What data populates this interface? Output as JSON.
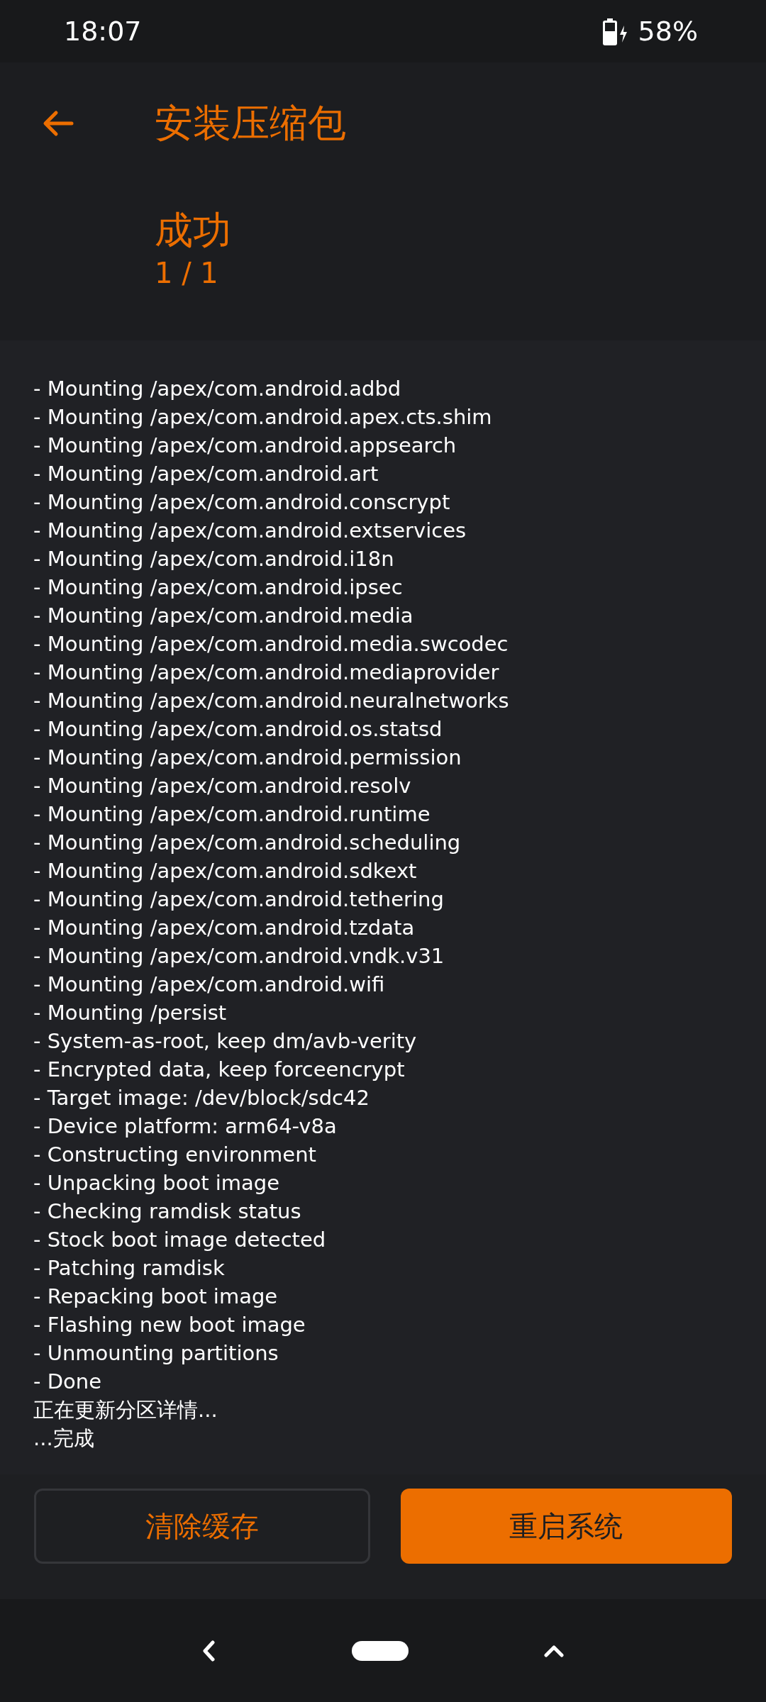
{
  "status_bar": {
    "time": "18:07",
    "battery": "58%"
  },
  "header": {
    "title": "安装压缩包"
  },
  "result": {
    "status": "成功",
    "progress": "1 / 1"
  },
  "log": [
    "- Mounting /apex/com.android.adbd",
    "- Mounting /apex/com.android.apex.cts.shim",
    "- Mounting /apex/com.android.appsearch",
    "- Mounting /apex/com.android.art",
    "- Mounting /apex/com.android.conscrypt",
    "- Mounting /apex/com.android.extservices",
    "- Mounting /apex/com.android.i18n",
    "- Mounting /apex/com.android.ipsec",
    "- Mounting /apex/com.android.media",
    "- Mounting /apex/com.android.media.swcodec",
    "- Mounting /apex/com.android.mediaprovider",
    "- Mounting /apex/com.android.neuralnetworks",
    "- Mounting /apex/com.android.os.statsd",
    "- Mounting /apex/com.android.permission",
    "- Mounting /apex/com.android.resolv",
    "- Mounting /apex/com.android.runtime",
    "- Mounting /apex/com.android.scheduling",
    "- Mounting /apex/com.android.sdkext",
    "- Mounting /apex/com.android.tethering",
    "- Mounting /apex/com.android.tzdata",
    "- Mounting /apex/com.android.vndk.v31",
    "- Mounting /apex/com.android.wifi",
    "- Mounting /persist",
    "- System-as-root, keep dm/avb-verity",
    "- Encrypted data, keep forceencrypt",
    "- Target image: /dev/block/sdc42",
    "- Device platform: arm64-v8a",
    "- Constructing environment",
    "- Unpacking boot image",
    "- Checking ramdisk status",
    "- Stock boot image detected",
    "- Patching ramdisk",
    "- Repacking boot image",
    "- Flashing new boot image",
    "- Unmounting partitions",
    "- Done",
    "正在更新分区详情...",
    "...完成"
  ],
  "buttons": [
    {
      "label": "清除缓存",
      "kind": "outlined"
    },
    {
      "label": "重启系统",
      "kind": "filled"
    }
  ]
}
